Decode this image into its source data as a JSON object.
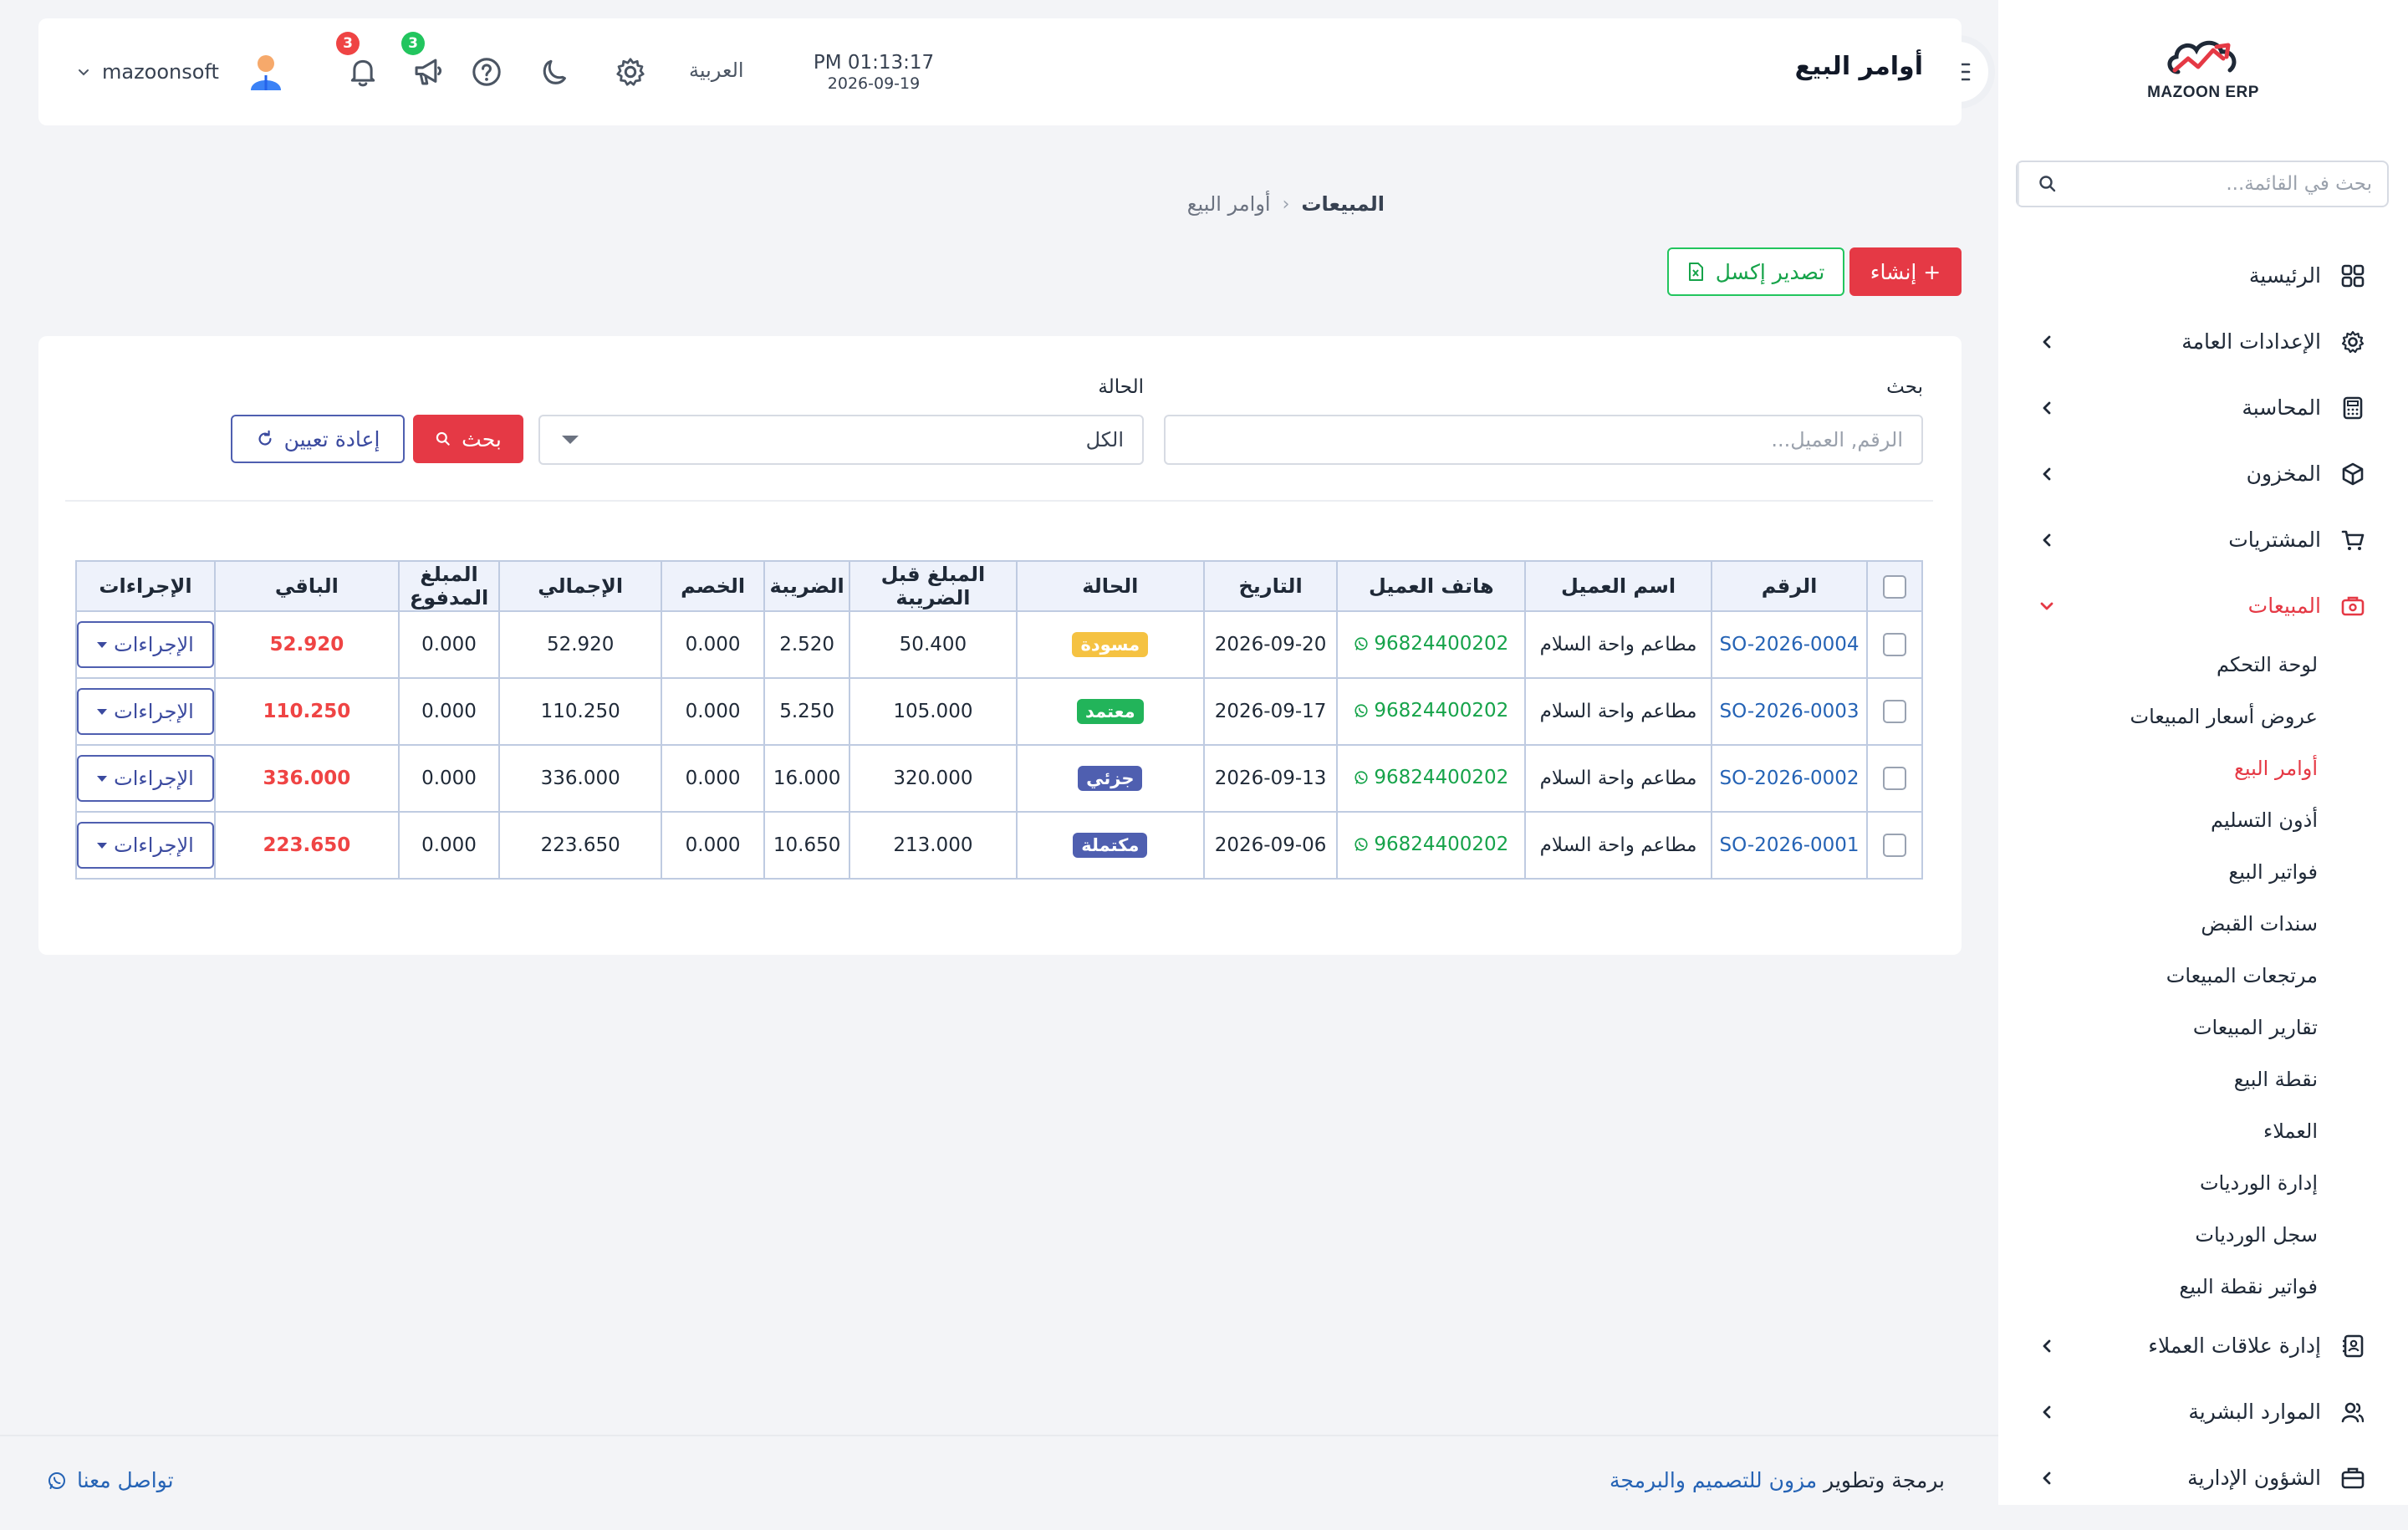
{
  "app": {
    "logo_text": "MAZOON ERP",
    "page_title": "أوامر البيع",
    "colors": {
      "accent": "#e53945",
      "link": "#2563b5",
      "success": "#22c55e",
      "primary_outline": "#4f5fb0"
    }
  },
  "header": {
    "time": "PM 01:13:17",
    "date": "2026-09-19",
    "language": "العربية",
    "notifications_count": "3",
    "announcements_count": "3",
    "username": "mazoonsoft",
    "icons": [
      "settings-icon",
      "moon-icon",
      "help-icon",
      "megaphone-icon",
      "bell-icon",
      "avatar"
    ]
  },
  "sidebar": {
    "search_placeholder": "بحث في القائمة...",
    "items": [
      {
        "label": "الرئيسية",
        "icon": "grid-icon"
      },
      {
        "label": "الإعدادات العامة",
        "icon": "gear-icon"
      },
      {
        "label": "المحاسبة",
        "icon": "calculator-icon"
      },
      {
        "label": "المخزون",
        "icon": "box-icon"
      },
      {
        "label": "المشتريات",
        "icon": "cart-icon"
      },
      {
        "label": "المبيعات",
        "icon": "sales-icon"
      },
      {
        "label": "إدارة علاقات العملاء",
        "icon": "contacts-icon"
      },
      {
        "label": "الموارد البشرية",
        "icon": "users-icon"
      },
      {
        "label": "الشؤون الإدارية",
        "icon": "briefcase-icon"
      }
    ],
    "sales_sub": [
      "لوحة التحكم",
      "عروض أسعار المبيعات",
      "أوامر البيع",
      "أذون التسليم",
      "فواتير البيع",
      "سندات القبض",
      "مرتجعات المبيعات",
      "تقارير المبيعات",
      "نقطة البيع",
      "العملاء",
      "إدارة الورديات",
      "سجل الورديات",
      "فواتير نقطة البيع"
    ]
  },
  "breadcrumb": {
    "root": "المبيعات",
    "current": "أوامر البيع"
  },
  "actions": {
    "create": "+ إنشاء",
    "export": "تصدير إكسل"
  },
  "filters": {
    "search_label": "بحث",
    "search_placeholder": "الرقم, العميل...",
    "status_label": "الحالة",
    "status_value": "الكل",
    "search_button": "بحث",
    "reset_button": "إعادة تعيين"
  },
  "table": {
    "headers": [
      "الرقم",
      "اسم العميل",
      "هاتف العميل",
      "التاريخ",
      "الحالة",
      "المبلغ قبل الضريبة",
      "الضريبة",
      "الخصم",
      "الإجمالي",
      "المبلغ المدفوع",
      "الباقي",
      "الإجراءات"
    ],
    "action_label": "الإجراءات",
    "rows": [
      {
        "number": "SO-2026-0004",
        "customer": "مطاعم واحة السلام",
        "phone": "96824400202",
        "date": "2026-09-20",
        "status": "مسودة",
        "status_color": "#f5c242",
        "before_tax": "50.400",
        "tax": "2.520",
        "discount": "0.000",
        "total": "52.920",
        "paid": "0.000",
        "remaining": "52.920"
      },
      {
        "number": "SO-2026-0003",
        "customer": "مطاعم واحة السلام",
        "phone": "96824400202",
        "date": "2026-09-17",
        "status": "معتمد",
        "status_color": "#22b45a",
        "before_tax": "105.000",
        "tax": "5.250",
        "discount": "0.000",
        "total": "110.250",
        "paid": "0.000",
        "remaining": "110.250"
      },
      {
        "number": "SO-2026-0002",
        "customer": "مطاعم واحة السلام",
        "phone": "96824400202",
        "date": "2026-09-13",
        "status": "جزئي",
        "status_color": "#4f5fb0",
        "before_tax": "320.000",
        "tax": "16.000",
        "discount": "0.000",
        "total": "336.000",
        "paid": "0.000",
        "remaining": "336.000"
      },
      {
        "number": "SO-2026-0001",
        "customer": "مطاعم واحة السلام",
        "phone": "96824400202",
        "date": "2026-09-06",
        "status": "مكتملة",
        "status_color": "#4f5fb0",
        "before_tax": "213.000",
        "tax": "10.650",
        "discount": "0.000",
        "total": "223.650",
        "paid": "0.000",
        "remaining": "223.650"
      }
    ]
  },
  "footer": {
    "prefix": "برمجة وتطوير",
    "brand": "مزون للتصميم والبرمجة",
    "contact": "تواصل معنا"
  }
}
